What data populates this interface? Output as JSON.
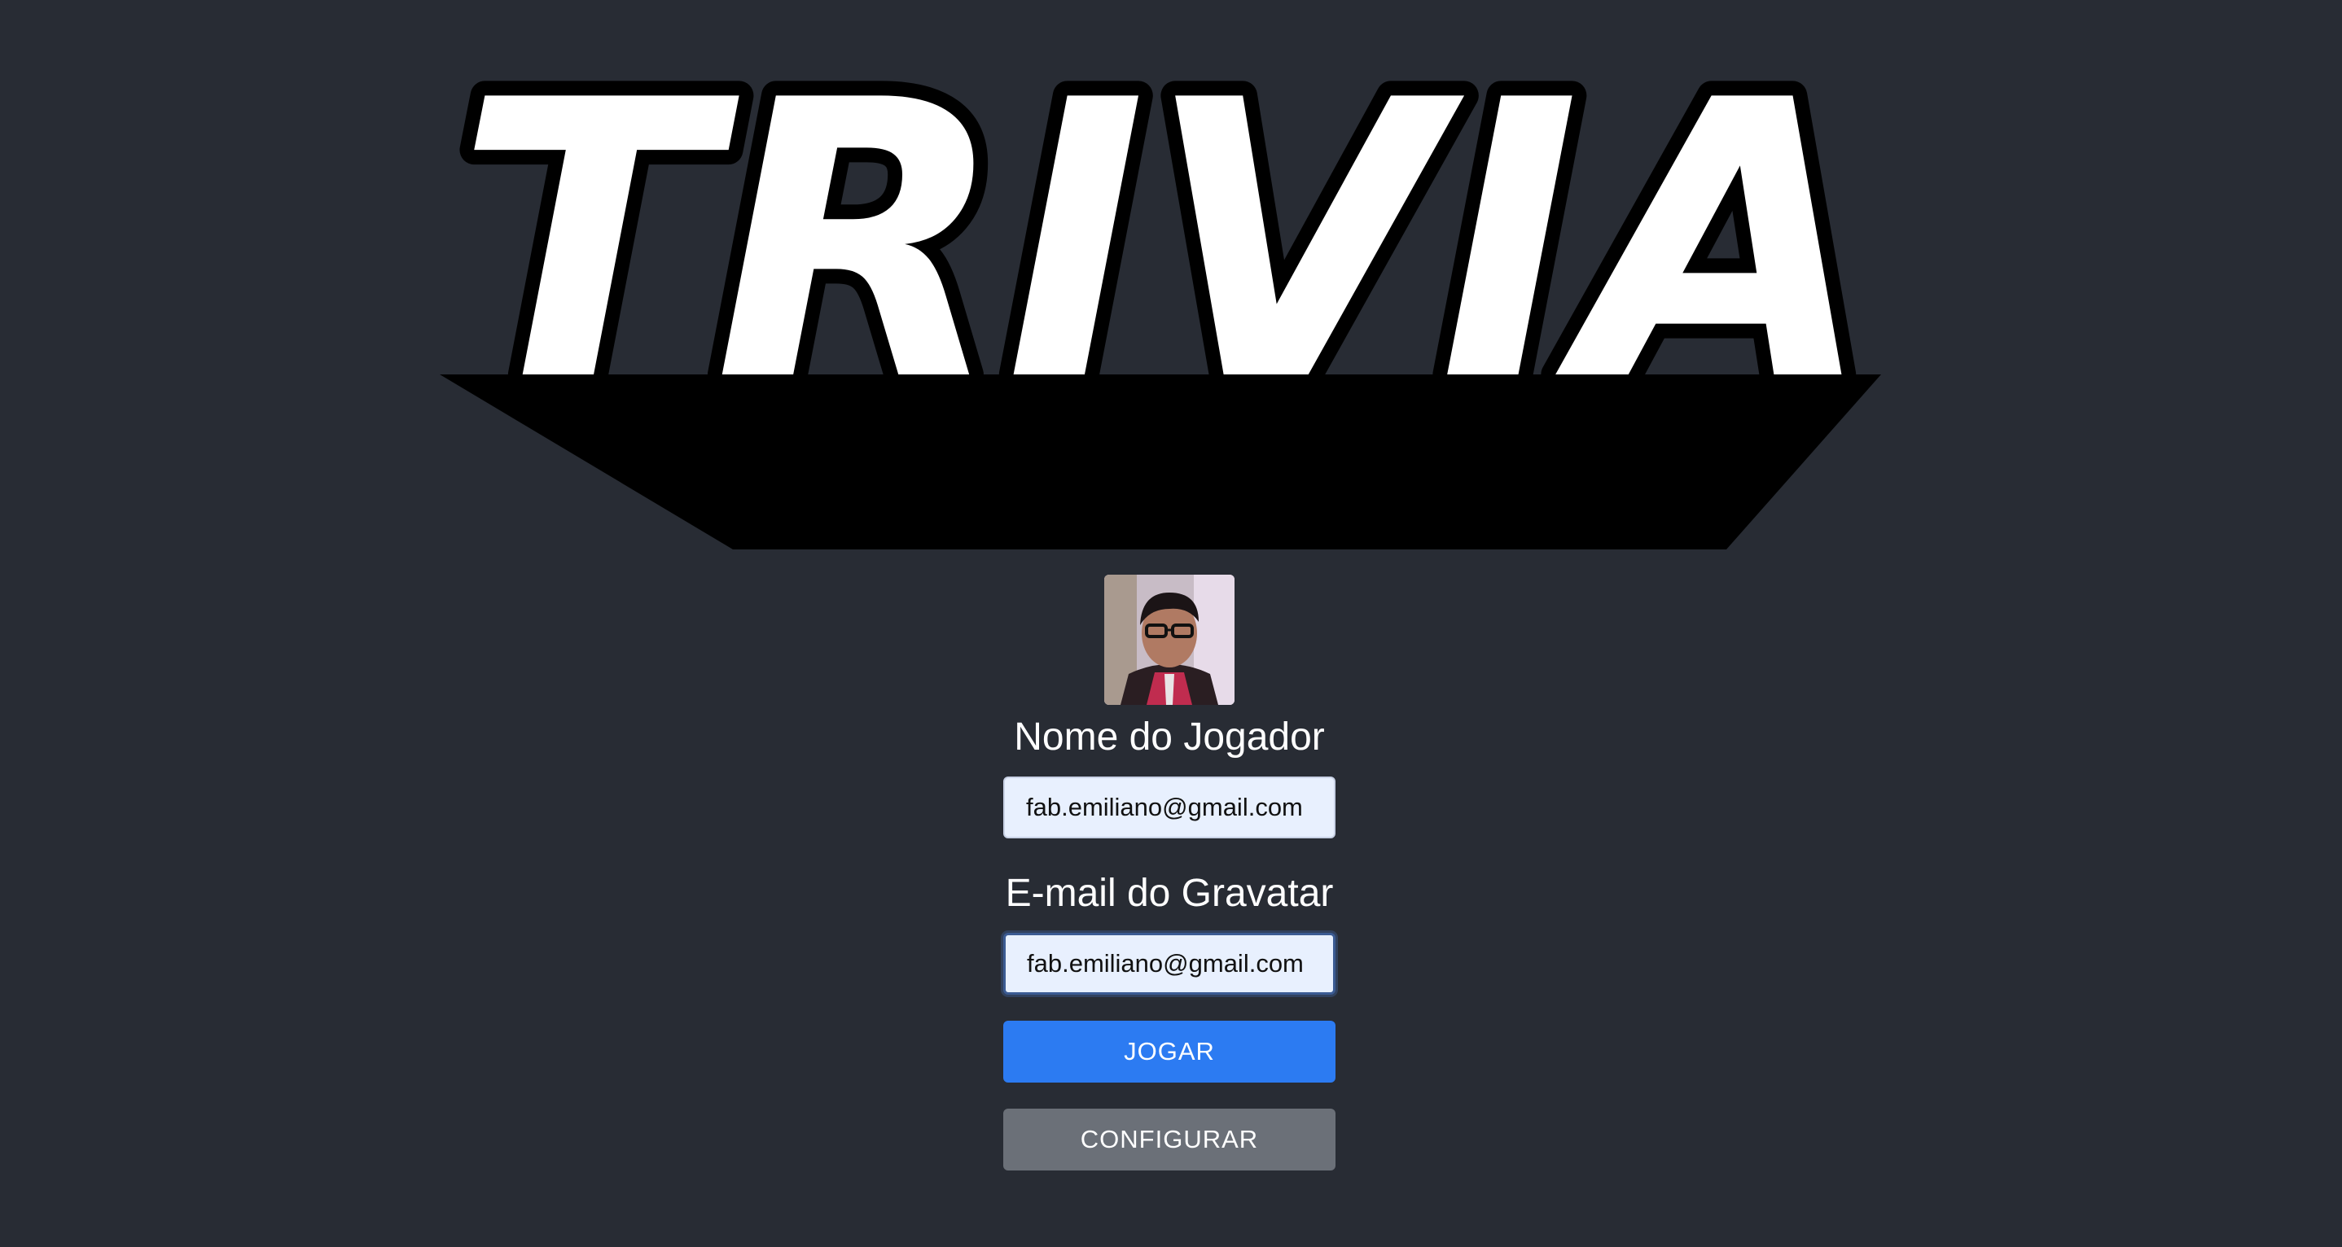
{
  "logo": {
    "text": "TRIVIA",
    "icon": "trivia-logo"
  },
  "player": {
    "avatar_icon": "player-avatar",
    "name_label": "Nome do Jogador",
    "name_value": "fab.emiliano@gmail.com",
    "email_label": "E-mail do Gravatar",
    "email_value": "fab.emiliano@gmail.com"
  },
  "actions": {
    "play_label": "JOGAR",
    "settings_label": "CONFIGURAR"
  },
  "colors": {
    "background": "#282c34",
    "primary": "#2c7bf2",
    "secondary": "#6b7078"
  }
}
